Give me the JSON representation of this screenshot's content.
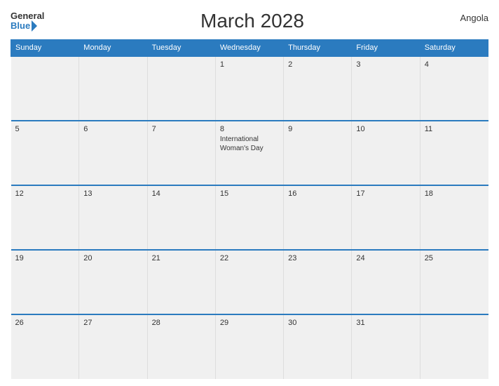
{
  "header": {
    "logo_general": "General",
    "logo_blue": "Blue",
    "title": "March 2028",
    "country": "Angola"
  },
  "days_of_week": [
    "Sunday",
    "Monday",
    "Tuesday",
    "Wednesday",
    "Thursday",
    "Friday",
    "Saturday"
  ],
  "weeks": [
    [
      {
        "day": "",
        "event": ""
      },
      {
        "day": "",
        "event": ""
      },
      {
        "day": "",
        "event": ""
      },
      {
        "day": "1",
        "event": ""
      },
      {
        "day": "2",
        "event": ""
      },
      {
        "day": "3",
        "event": ""
      },
      {
        "day": "4",
        "event": ""
      }
    ],
    [
      {
        "day": "5",
        "event": ""
      },
      {
        "day": "6",
        "event": ""
      },
      {
        "day": "7",
        "event": ""
      },
      {
        "day": "8",
        "event": "International\nWoman's Day"
      },
      {
        "day": "9",
        "event": ""
      },
      {
        "day": "10",
        "event": ""
      },
      {
        "day": "11",
        "event": ""
      }
    ],
    [
      {
        "day": "12",
        "event": ""
      },
      {
        "day": "13",
        "event": ""
      },
      {
        "day": "14",
        "event": ""
      },
      {
        "day": "15",
        "event": ""
      },
      {
        "day": "16",
        "event": ""
      },
      {
        "day": "17",
        "event": ""
      },
      {
        "day": "18",
        "event": ""
      }
    ],
    [
      {
        "day": "19",
        "event": ""
      },
      {
        "day": "20",
        "event": ""
      },
      {
        "day": "21",
        "event": ""
      },
      {
        "day": "22",
        "event": ""
      },
      {
        "day": "23",
        "event": ""
      },
      {
        "day": "24",
        "event": ""
      },
      {
        "day": "25",
        "event": ""
      }
    ],
    [
      {
        "day": "26",
        "event": ""
      },
      {
        "day": "27",
        "event": ""
      },
      {
        "day": "28",
        "event": ""
      },
      {
        "day": "29",
        "event": ""
      },
      {
        "day": "30",
        "event": ""
      },
      {
        "day": "31",
        "event": ""
      },
      {
        "day": "",
        "event": ""
      }
    ]
  ]
}
